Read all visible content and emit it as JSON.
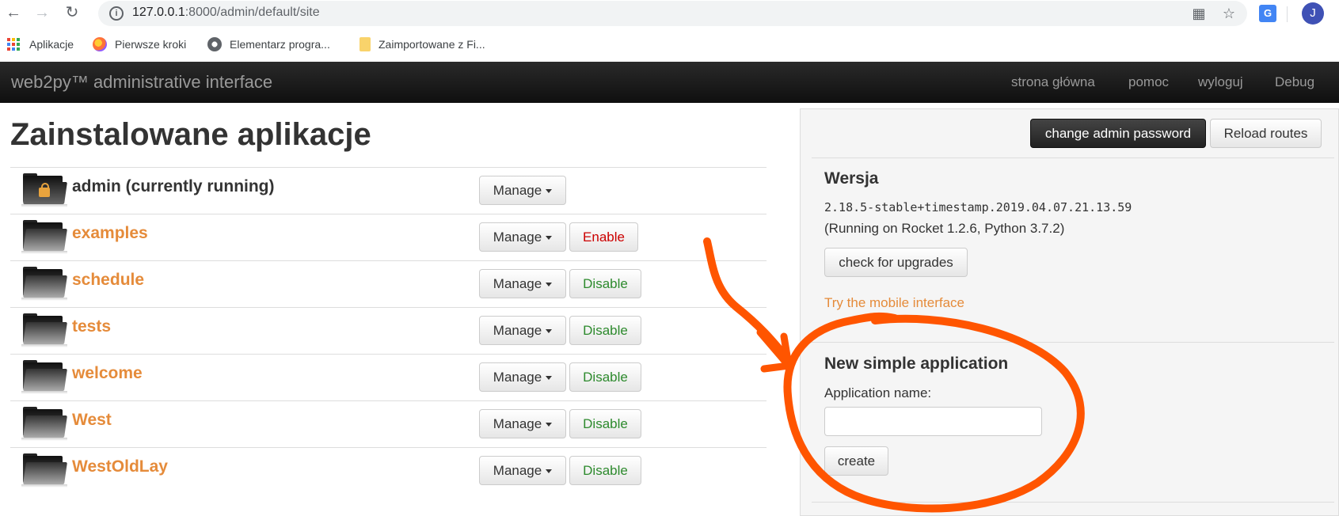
{
  "browser": {
    "url_host": "127.0.0.1",
    "url_path": ":8000/admin/default/site",
    "profile_initial": "J",
    "extension_label": "G",
    "bookmarks": [
      {
        "label": "Aplikacje",
        "icon": "apps-grid-icon"
      },
      {
        "label": "Pierwsze kroki",
        "icon": "firefox-icon"
      },
      {
        "label": "Elementarz progra...",
        "icon": "globe-icon"
      },
      {
        "label": "Zaimportowane z Fi...",
        "icon": "folder-icon"
      }
    ]
  },
  "navbar": {
    "brand": "web2py™ administrative interface",
    "links": [
      "strona główna",
      "pomoc",
      "wyloguj",
      "Debug"
    ]
  },
  "main": {
    "title": "Zainstalowane aplikacje",
    "manage_label": "Manage",
    "apps": [
      {
        "name": "admin (currently running)",
        "action": ""
      },
      {
        "name": "examples",
        "action": "Enable"
      },
      {
        "name": "schedule",
        "action": "Disable"
      },
      {
        "name": "tests",
        "action": "Disable"
      },
      {
        "name": "welcome",
        "action": "Disable"
      },
      {
        "name": "West",
        "action": "Disable"
      },
      {
        "name": "WestOldLay",
        "action": "Disable"
      }
    ]
  },
  "sidebar": {
    "change_password": "change admin password",
    "reload_routes": "Reload routes",
    "version_heading": "Wersja",
    "version": "2.18.5-stable+timestamp.2019.04.07.21.13.59",
    "running": "(Running on Rocket 1.2.6, Python 3.7.2)",
    "check_upgrades": "check for upgrades",
    "mobile_link": "Try the mobile interface",
    "new_app_heading": "New simple application",
    "app_name_label": "Application name:",
    "app_name_value": "",
    "create_label": "create"
  },
  "colors": {
    "link": "#e58b3a",
    "annotation": "#ff5500",
    "enable": "#cc0000",
    "disable": "#2d8a2d"
  }
}
